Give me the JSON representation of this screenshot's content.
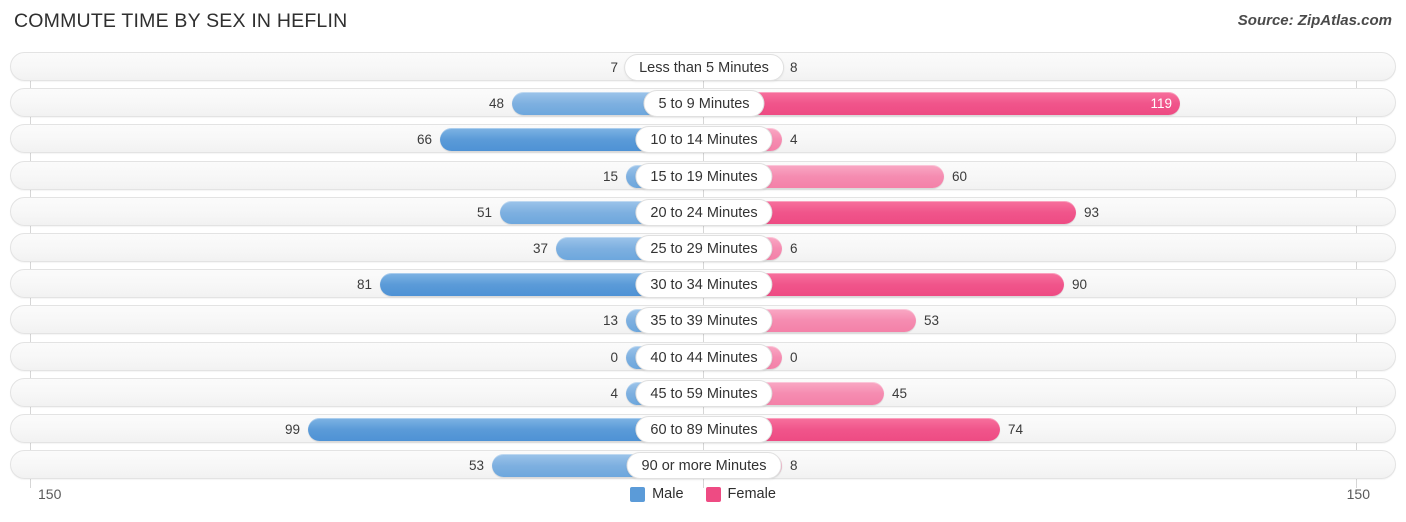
{
  "header": {
    "title": "COMMUTE TIME BY SEX IN HEFLIN",
    "source": "Source: ZipAtlas.com"
  },
  "axis": {
    "left_label": "150",
    "right_label": "150",
    "max": 150
  },
  "legend": {
    "items": [
      {
        "label": "Male",
        "color": "#5b9bd8"
      },
      {
        "label": "Female",
        "color": "#ee4b83"
      }
    ]
  },
  "colors": {
    "male_light": "#9cc4ea",
    "male_dark": "#5b9bd8",
    "female_light": "#f9a8c4",
    "female_dark": "#ee4b83",
    "row_bg": "#f7f7f7",
    "grid": "#d6d6d6"
  },
  "chart_data": {
    "type": "bar",
    "orientation": "horizontal-diverging",
    "title": "COMMUTE TIME BY SEX IN HEFLIN",
    "xlabel": "",
    "ylabel": "",
    "xlim": [
      150,
      150
    ],
    "grid": true,
    "legend_position": "bottom-center",
    "categories": [
      "Less than 5 Minutes",
      "5 to 9 Minutes",
      "10 to 14 Minutes",
      "15 to 19 Minutes",
      "20 to 24 Minutes",
      "25 to 29 Minutes",
      "30 to 34 Minutes",
      "35 to 39 Minutes",
      "40 to 44 Minutes",
      "45 to 59 Minutes",
      "60 to 89 Minutes",
      "90 or more Minutes"
    ],
    "series": [
      {
        "name": "Male",
        "values": [
          7,
          48,
          66,
          15,
          51,
          37,
          81,
          13,
          0,
          4,
          99,
          53
        ]
      },
      {
        "name": "Female",
        "values": [
          8,
          119,
          4,
          60,
          93,
          6,
          90,
          53,
          0,
          45,
          74,
          8
        ]
      }
    ]
  }
}
